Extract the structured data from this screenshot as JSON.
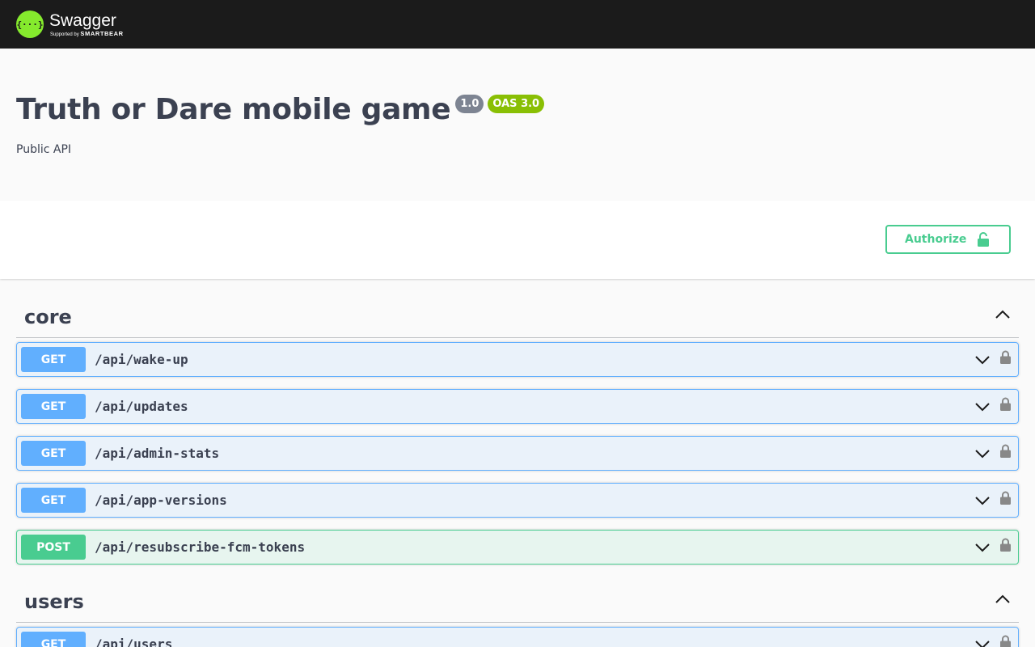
{
  "topbar": {
    "logo_glyph": "{···}",
    "brand": "Swagger",
    "supported_by": "Supported by",
    "smartbear": "SMARTBEAR"
  },
  "info": {
    "title": "Truth or Dare mobile game",
    "version": "1.0",
    "oas": "OAS 3.0",
    "description": "Public API"
  },
  "authorize": {
    "label": "Authorize",
    "icon": "lock-open-icon"
  },
  "colors": {
    "get": "#61affe",
    "post": "#49cc90",
    "badge_oas": "#89bf04",
    "badge_version": "#7d8492",
    "topbar": "#1b1b1b"
  },
  "tags": [
    {
      "name": "core",
      "operations": [
        {
          "method": "GET",
          "path": "/api/wake-up"
        },
        {
          "method": "GET",
          "path": "/api/updates"
        },
        {
          "method": "GET",
          "path": "/api/admin-stats"
        },
        {
          "method": "GET",
          "path": "/api/app-versions"
        },
        {
          "method": "POST",
          "path": "/api/resubscribe-fcm-tokens"
        }
      ]
    },
    {
      "name": "users",
      "operations": [
        {
          "method": "GET",
          "path": "/api/users"
        }
      ]
    }
  ]
}
